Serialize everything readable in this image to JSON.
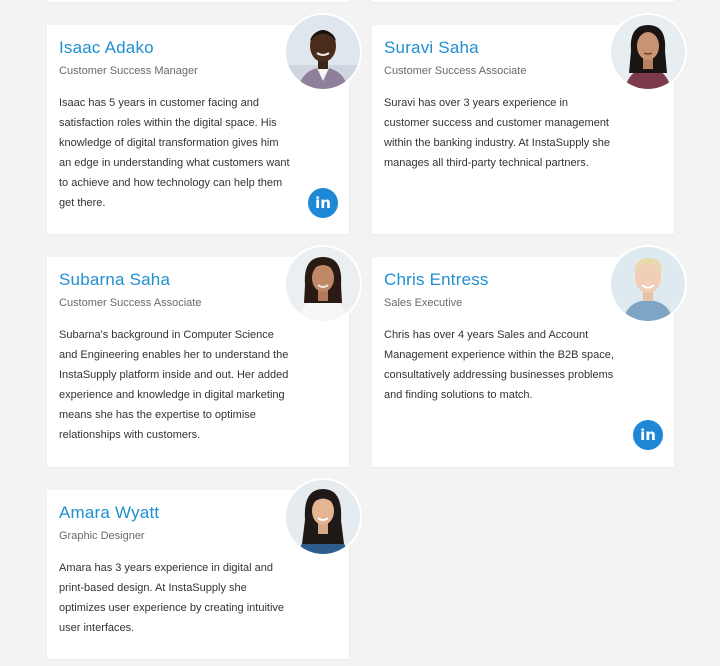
{
  "team": [
    {
      "name": "Isaac Adako",
      "role": "Customer Success Manager",
      "bio": "Isaac has 5 years in customer facing and satisfaction roles within the digital space. His knowledge of digital transformation gives him an edge in understanding what customers want to achieve and how technology can help them get there.",
      "linkedin": "in"
    },
    {
      "name": "Suravi Saha",
      "role": "Customer Success Associate",
      "bio": "Suravi has over 3 years experience in customer success and customer management within the banking industry. At InstaSupply she manages all third-party technical partners."
    },
    {
      "name": "Subarna Saha",
      "role": "Customer Success Associate",
      "bio": "Subarna's background in Computer Science and Engineering enables her to understand the InstaSupply platform inside and out. Her added experience and knowledge in digital marketing means she has the expertise to optimise relationships with customers."
    },
    {
      "name": "Chris Entress",
      "role": "Sales Executive",
      "bio": "Chris has over 4 years Sales and Account Management experience within the B2B space, consultatively addressing businesses problems and finding solutions to match.",
      "linkedin": "in"
    },
    {
      "name": "Amara Wyatt",
      "role": "Graphic Designer",
      "bio": "Amara has 3 years experience in digital and print-based design. At InstaSupply she optimizes user experience by creating intuitive user interfaces."
    }
  ],
  "colors": {
    "accent": "#1f8fd1",
    "linkedin": "#1e88d6",
    "background": "#f3f3f3"
  }
}
